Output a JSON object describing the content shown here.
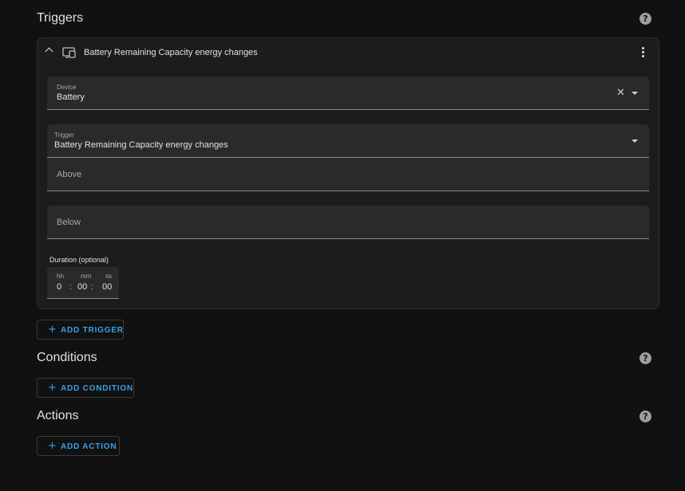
{
  "triggers": {
    "title": "Triggers",
    "help_glyph": "?",
    "card": {
      "title": "Battery Remaining Capacity energy changes",
      "device": {
        "label": "Device",
        "value": "Battery",
        "clear_glyph": "✕"
      },
      "trigger": {
        "label": "Trigger",
        "value": "Battery Remaining Capacity energy changes"
      },
      "above": {
        "placeholder": "Above"
      },
      "below": {
        "placeholder": "Below"
      },
      "duration": {
        "label": "Duration (optional)",
        "hh_label": "hh",
        "mm_label": "mm",
        "ss_label": "ss",
        "hh": "0",
        "mm": "00",
        "ss": "00",
        "separator": ":"
      }
    },
    "add_button": {
      "icon": "+",
      "label": "ADD TRIGGER"
    }
  },
  "conditions": {
    "title": "Conditions",
    "help_glyph": "?",
    "add_button": {
      "icon": "+",
      "label": "ADD CONDITION"
    }
  },
  "actions": {
    "title": "Actions",
    "help_glyph": "?",
    "add_button": {
      "icon": "+",
      "label": "ADD ACTION"
    }
  },
  "colors": {
    "background": "#111111",
    "card": "#1c1c1c",
    "field": "#2a2a2a",
    "accent": "#39a0e6"
  }
}
